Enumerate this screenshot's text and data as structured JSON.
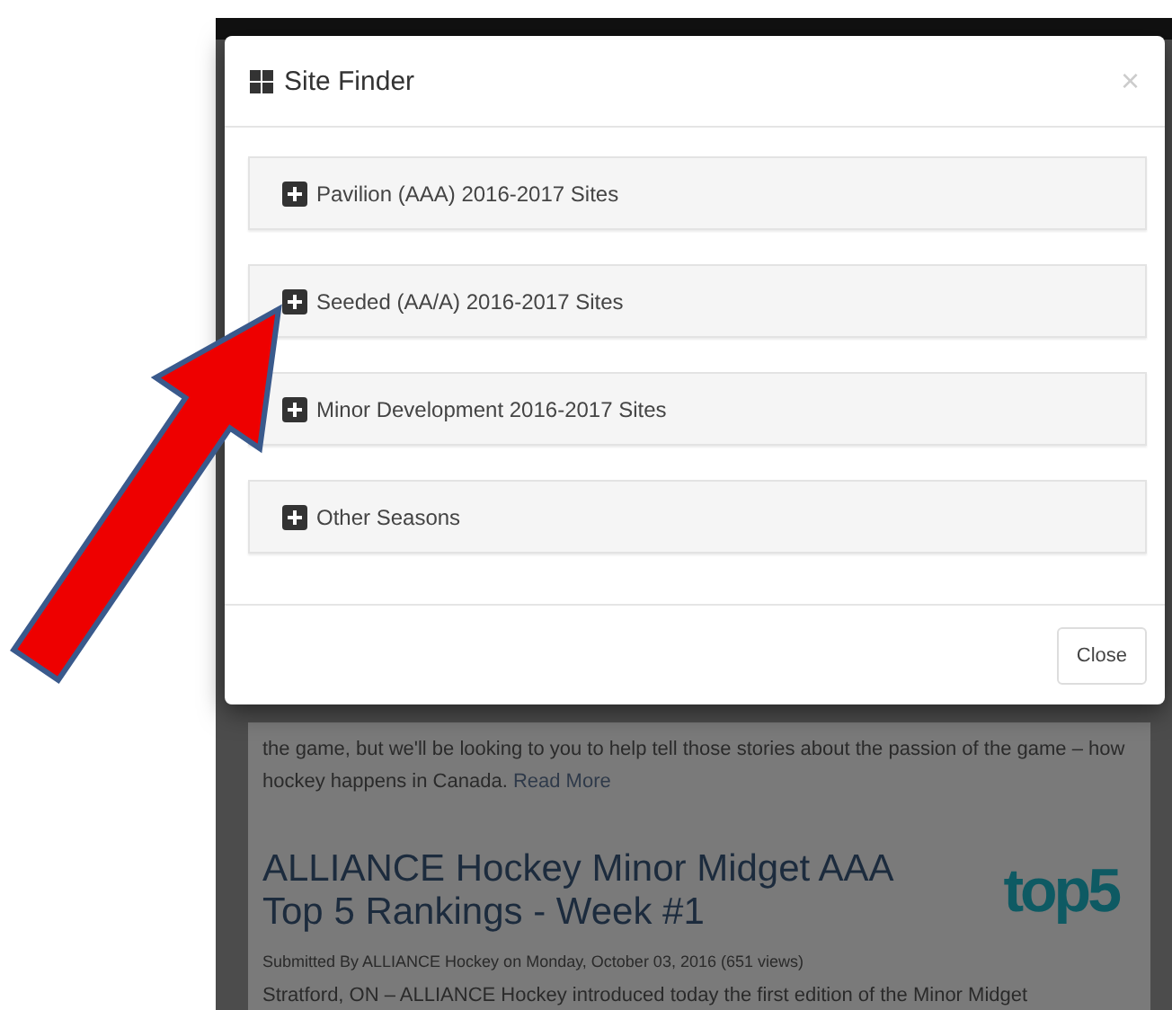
{
  "modal": {
    "title": "Site Finder",
    "close_symbol": "×",
    "sections": [
      {
        "label": "Pavilion (AAA) 2016-2017 Sites",
        "expanded": false
      },
      {
        "label": "Seeded (AA/A) 2016-2017 Sites",
        "expanded": false
      },
      {
        "label": "Minor Development 2016-2017 Sites",
        "expanded": false
      },
      {
        "label": "Other Seasons",
        "expanded": false
      }
    ],
    "footer_button": "Close"
  },
  "article": {
    "intro": "the game, but we'll be looking to you to help tell those stories about the passion of the game – how hockey happens in Canada.",
    "read_more": "Read More",
    "title": "ALLIANCE Hockey Minor Midget AAA Top 5 Rankings - Week #1",
    "meta": "Submitted By ALLIANCE Hockey on Monday, October 03, 2016 (651 views)",
    "body": "Stratford, ON – ALLIANCE Hockey introduced today the first edition of the Minor Midget",
    "logo_text": "top5"
  }
}
